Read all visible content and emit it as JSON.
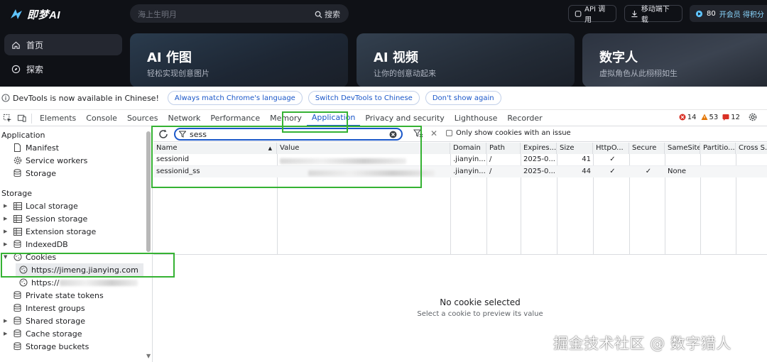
{
  "app": {
    "logo_text": "即梦AI",
    "search_placeholder": "海上生明月",
    "search_button": "搜索",
    "api_label": "API 调用",
    "mobile_label": "移动端下载",
    "credits": "80",
    "vip_label": "开会员 得积分",
    "nav": [
      {
        "label": "首页",
        "icon": "home-icon"
      },
      {
        "label": "探索",
        "icon": "compass-icon"
      }
    ],
    "cards": [
      {
        "title": "AI 作图",
        "subtitle": "轻松实现创意图片"
      },
      {
        "title": "AI 视频",
        "subtitle": "让你的创意动起来"
      },
      {
        "title": "数字人",
        "subtitle": "虚拟角色从此栩栩如生"
      }
    ]
  },
  "devtools": {
    "infobar": {
      "message": "DevTools is now available in Chinese!",
      "buttons": [
        "Always match Chrome's language",
        "Switch DevTools to Chinese",
        "Don't show again"
      ]
    },
    "tabs": [
      "Elements",
      "Console",
      "Sources",
      "Network",
      "Performance",
      "Memory",
      "Application",
      "Privacy and security",
      "Lighthouse",
      "Recorder"
    ],
    "selected_tab": "Application",
    "counts": {
      "errors": "14",
      "warnings": "53",
      "issues": "12"
    },
    "sidebar": {
      "application_header": "Application",
      "application_items": [
        "Manifest",
        "Service workers",
        "Storage"
      ],
      "storage_header": "Storage",
      "storage_items": [
        "Local storage",
        "Session storage",
        "Extension storage",
        "IndexedDB",
        "Cookies"
      ],
      "cookie_origin": "https://jimeng.jianying.com",
      "cookie_origin_2_prefix": "https://",
      "more_items": [
        "Private state tokens",
        "Interest groups",
        "Shared storage",
        "Cache storage",
        "Storage buckets"
      ]
    },
    "filter": {
      "value": "sess",
      "only_issue_label": "Only show cookies with an issue"
    },
    "table": {
      "columns": [
        "Name",
        "Value",
        "Domain",
        "Path",
        "Expires...",
        "Size",
        "HttpO...",
        "Secure",
        "SameSite",
        "Partitio...",
        "Cross S..."
      ],
      "rows": [
        {
          "name": "sessionid",
          "domain": ".jianyin...",
          "path": "/",
          "expires": "2025-0...",
          "size": "41",
          "httponly": "✓",
          "secure": "",
          "samesite": ""
        },
        {
          "name": "sessionid_ss",
          "domain": ".jianyin...",
          "path": "/",
          "expires": "2025-0...",
          "size": "44",
          "httponly": "✓",
          "secure": "✓",
          "samesite": "None"
        }
      ]
    },
    "preview": {
      "title": "No cookie selected",
      "subtitle": "Select a cookie to preview its value"
    }
  },
  "watermark": "掘金技术社区 @ 数字猎人"
}
